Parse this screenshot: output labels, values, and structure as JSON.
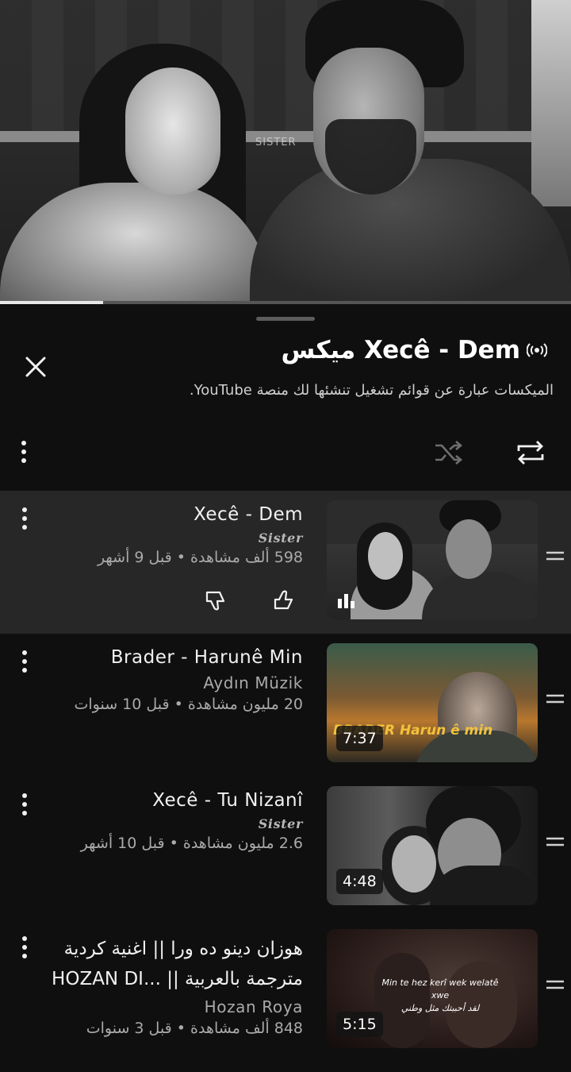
{
  "video": {
    "watermark": "SISTER",
    "progress_fraction": 0.18
  },
  "panel": {
    "title": "ميكس Xecê - Dem",
    "subtitle": "الميكسات عبارة عن قوائم تشغيل تنشئها لك منصة YouTube.",
    "icons": {
      "close": "close-icon",
      "mix": "mix-broadcast-icon",
      "menu": "more-vertical-icon",
      "shuffle": "shuffle-icon",
      "repeat": "repeat-icon"
    },
    "colors": {
      "background": "#0f0f0f",
      "current_item": "#272727",
      "text_primary": "#f1f1f1",
      "text_secondary": "#aaaaaa"
    }
  },
  "items": [
    {
      "title": "Xecê - Dem",
      "channel": "Sister",
      "stats": "598 ألف مشاهدة • قبل 9 أشهر",
      "duration": "",
      "now_playing": true,
      "actions": {
        "like": "like-icon",
        "dislike": "dislike-icon"
      }
    },
    {
      "title": "Brader - Harunê Min",
      "channel": "Aydın Müzik",
      "stats": "20 مليون مشاهدة • قبل 10 سنوات",
      "duration": "7:37",
      "thumb_text": "BRADER Harun ê min"
    },
    {
      "title": "Xecê - Tu Nizanî",
      "channel": "Sister",
      "stats": "2.6 مليون مشاهدة • قبل 10 أشهر",
      "duration": "4:48"
    },
    {
      "title": "هوزان دينو ده ورا || اغنية كردية مترجمة بالعربية || ...HOZAN DI",
      "channel": "Hozan Roya",
      "stats": "848 ألف مشاهدة • قبل 3 سنوات",
      "duration": "5:15",
      "thumb_caption_1": "Min te hez kerî wek welatê xwe",
      "thumb_caption_2": "لقد أحببتك مثل وطني"
    }
  ]
}
